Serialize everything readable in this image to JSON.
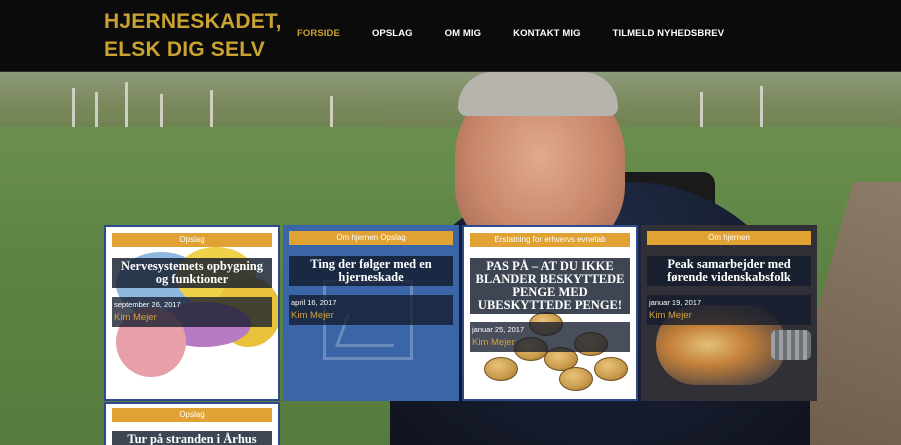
{
  "header": {
    "site_title": "HJERNESKADET, ELSK DIG SELV",
    "nav": [
      {
        "label": "FORSIDE",
        "active": true
      },
      {
        "label": "OPSLAG",
        "active": false
      },
      {
        "label": "OM MIG",
        "active": false
      },
      {
        "label": "KONTAKT MIG",
        "active": false
      },
      {
        "label": "TILMELD NYHEDSBREV",
        "active": false
      }
    ]
  },
  "colors": {
    "accent": "#c9a233",
    "category_bar": "#e0a233",
    "card_frame": "#2d4b8a"
  },
  "posts": [
    {
      "category": "Opslag",
      "title": "Nervesystemets opbygning og funktioner",
      "date": "september 26, 2017",
      "author": "Kim Mejer"
    },
    {
      "category": "Om hjernen Opslag",
      "title": "Ting der følger med en hjerneskade",
      "date": "april 16, 2017",
      "author": "Kim Mejer"
    },
    {
      "category": "Erstatning for erhvervs evnetab",
      "title": "PAS PÅ – AT DU IKKE BLANDER BESKYTTEDE PENGE MED UBESKYTTEDE PENGE!",
      "date": "januar 25, 2017",
      "author": "Kim Mejer"
    },
    {
      "category": "Om hjernen",
      "title": "Peak samarbejder med førende videnskabsfolk",
      "date": "januar 19, 2017",
      "author": "Kim Mejer"
    },
    {
      "category": "Opslag",
      "title": "Tur på stranden i Århus"
    }
  ]
}
